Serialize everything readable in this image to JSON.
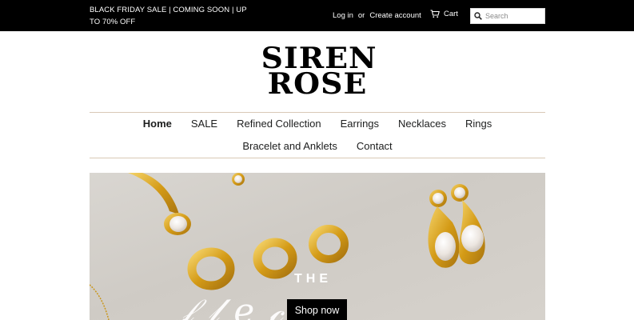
{
  "announcement": {
    "line1": "BLACK FRIDAY SALE | COMING SOON | UP",
    "line2": "TO 70% OFF"
  },
  "account": {
    "login_label": "Log in",
    "separator": "or",
    "create_label": "Create account"
  },
  "cart": {
    "label": "Cart",
    "icon": "cart-icon"
  },
  "search": {
    "placeholder": "Search",
    "icon": "search-icon"
  },
  "logo": {
    "line1": "SIREN",
    "line2": "ROSE"
  },
  "nav": {
    "row1": [
      {
        "label": "Home",
        "active": true
      },
      {
        "label": "SALE"
      },
      {
        "label": "Refined Collection"
      },
      {
        "label": "Earrings"
      },
      {
        "label": "Necklaces"
      },
      {
        "label": "Rings"
      }
    ],
    "row2": [
      {
        "label": "Bracelet and Anklets"
      },
      {
        "label": "Contact"
      }
    ]
  },
  "hero": {
    "overlay_the": "THE",
    "button_label": "Shop now"
  },
  "colors": {
    "topbar": "#000000",
    "nav_divider": "#d9c9b6",
    "hero_bg": "#d4d0ca",
    "gold": "#d9a520"
  }
}
